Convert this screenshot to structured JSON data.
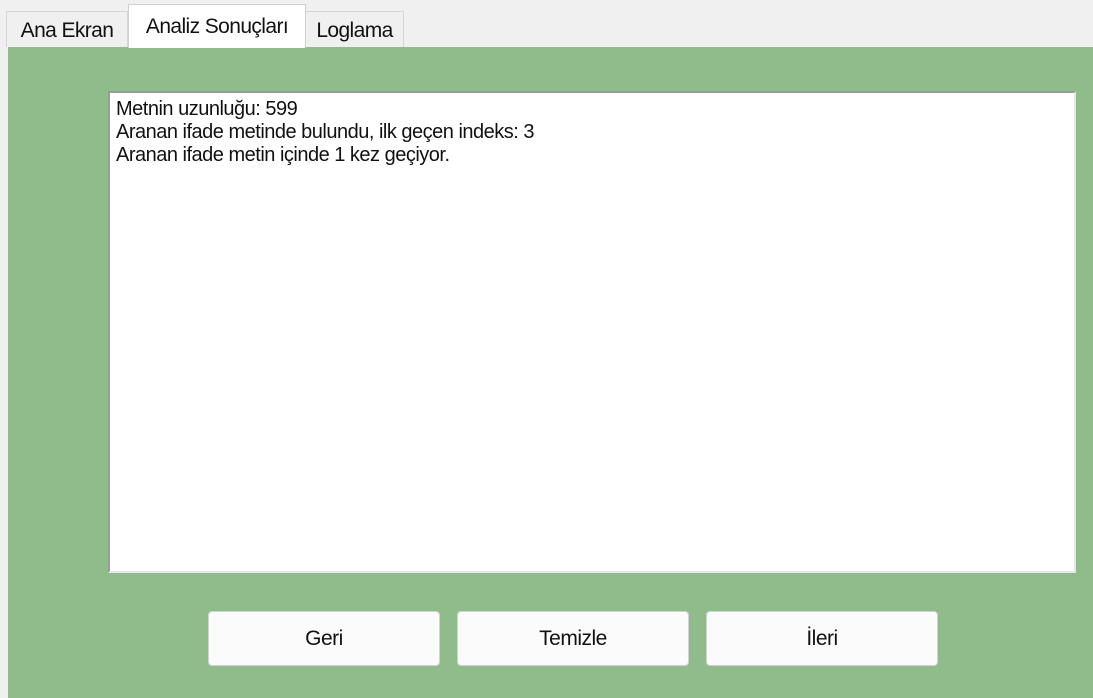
{
  "tabs": [
    {
      "label": "Ana Ekran",
      "active": false
    },
    {
      "label": "Analiz Sonuçları",
      "active": true
    },
    {
      "label": "Loglama",
      "active": false
    }
  ],
  "result": {
    "lines": [
      "Metnin uzunluğu: 599",
      "Aranan ifade metinde bulundu, ilk geçen indeks: 3",
      "Aranan ifade metin içinde 1 kez geçiyor."
    ]
  },
  "buttons": {
    "back_label": "Geri",
    "clear_label": "Temizle",
    "next_label": "İleri"
  },
  "colors": {
    "panel_background": "#8fbc8a",
    "tab_strip_background": "#f0f0f0",
    "text_area_background": "#ffffff"
  }
}
